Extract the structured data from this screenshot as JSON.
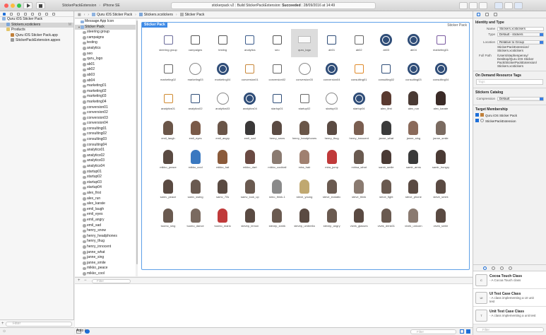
{
  "toolbar": {
    "scheme_target": "StickerPackExtension",
    "device": "iPhone SE",
    "activity_project": "stickerpack v2",
    "activity_status_prefix": "Build StickerPackExtension:",
    "activity_status": "Succeeded",
    "activity_time": "28/09/2016 at 14:49"
  },
  "navigator": {
    "items": [
      {
        "label": "Quru iOS Sticker Pack",
        "indent": 0,
        "kind": "project"
      },
      {
        "label": "Stickers.xcstickers",
        "indent": 1,
        "kind": "file",
        "badge": "M",
        "selected": true
      },
      {
        "label": "Products",
        "indent": 1,
        "kind": "folder"
      },
      {
        "label": "Quru iOS Sticker Pack.app",
        "indent": 2,
        "kind": "app"
      },
      {
        "label": "StickerPackExtension.appex",
        "indent": 2,
        "kind": "appex"
      }
    ],
    "filter_placeholder": "Filter"
  },
  "jumpbar": {
    "crumbs": [
      "Quru iOS Sticker Pack",
      "Stickers.xcstickers",
      "Sticker Pack"
    ]
  },
  "outline": {
    "items": [
      "Message App Icon",
      "Sticker Pack",
      "steering group",
      "campaigns",
      "testing",
      "analytics",
      "seo",
      "quru_logo",
      "ab01",
      "ab02",
      "ab03",
      "ab04",
      "marketing01",
      "marketing02",
      "marketing03",
      "marketing04",
      "conversion01",
      "conversion02",
      "conversion03",
      "conversion04",
      "consulting01",
      "consulting02",
      "consulting03",
      "consulting04",
      "analytics01",
      "analytics02",
      "analytics03",
      "analytics04",
      "startup01",
      "startup02",
      "startup03",
      "startup04",
      "alex_first",
      "alex_run",
      "alex_karate",
      "emil_laugh",
      "emil_eyes",
      "emil_angry",
      "emil_sad",
      "henry_snow",
      "henry_headphones",
      "henry_thug",
      "henry_innocent",
      "janne_what",
      "janne_sing",
      "janne_smile",
      "mikko_peace",
      "mikko_cool"
    ],
    "filter_placeholder": "Filter"
  },
  "pack": {
    "label": "Sticker Pack",
    "right_label": "Sticker Pack",
    "stickers": [
      {
        "name": "steering group",
        "kind": "icon",
        "color": "#6b6b9a"
      },
      {
        "name": "campaigns",
        "kind": "icon",
        "color": "#555"
      },
      {
        "name": "testing",
        "kind": "icon",
        "color": "#555"
      },
      {
        "name": "analytics",
        "kind": "icon",
        "color": "#3a5a8a"
      },
      {
        "name": "seo",
        "kind": "icon",
        "color": "#555"
      },
      {
        "name": "quru_logo",
        "kind": "logo",
        "color": "#bbb",
        "selected": true
      },
      {
        "name": "ab01",
        "kind": "icon",
        "color": "#2f4d78"
      },
      {
        "name": "ab02",
        "kind": "icon",
        "color": "#666"
      },
      {
        "name": "ab03",
        "kind": "circle",
        "color": "#2f4d78"
      },
      {
        "name": "ab04",
        "kind": "circle",
        "color": "#2f4d78"
      },
      {
        "name": "marketing01",
        "kind": "icon",
        "color": "#7a5aa0"
      },
      {
        "name": "marketing02",
        "kind": "icon",
        "color": "#666"
      },
      {
        "name": "marketing03",
        "kind": "ring",
        "color": "#888"
      },
      {
        "name": "marketing04",
        "kind": "circle",
        "color": "#2f4d78"
      },
      {
        "name": "conversion01",
        "kind": "icon",
        "color": "#c8873a"
      },
      {
        "name": "conversion02",
        "kind": "icon",
        "color": "#666"
      },
      {
        "name": "conversion03",
        "kind": "ring",
        "color": "#888"
      },
      {
        "name": "conversion04",
        "kind": "circle",
        "color": "#2f4d78"
      },
      {
        "name": "consulting01",
        "kind": "icon",
        "color": "#e08a2a"
      },
      {
        "name": "consulting02",
        "kind": "icon",
        "color": "#2f4d78"
      },
      {
        "name": "consulting03",
        "kind": "circle",
        "color": "#2f4d78"
      },
      {
        "name": "consulting04",
        "kind": "circle",
        "color": "#2f4d78"
      },
      {
        "name": "analytics01",
        "kind": "icon",
        "color": "#d08a30"
      },
      {
        "name": "analytics02",
        "kind": "icon",
        "color": "#2f4d78"
      },
      {
        "name": "analytics03",
        "kind": "ring",
        "color": "#888"
      },
      {
        "name": "analytics04",
        "kind": "circle",
        "color": "#2f4d78"
      },
      {
        "name": "startup01",
        "kind": "icon",
        "color": "#2f4d78"
      },
      {
        "name": "startup02",
        "kind": "icon",
        "color": "#666"
      },
      {
        "name": "startup03",
        "kind": "ring",
        "color": "#888"
      },
      {
        "name": "startup04",
        "kind": "circle",
        "color": "#2f4d78"
      },
      {
        "name": "alex_first",
        "kind": "photo",
        "color": "#5a3a30"
      },
      {
        "name": "alex_run",
        "kind": "photo",
        "color": "#4a3a34"
      },
      {
        "name": "alex_karate",
        "kind": "photo",
        "color": "#3a2a26"
      },
      {
        "name": "emil_laugh",
        "kind": "photo",
        "color": "#6a5548"
      },
      {
        "name": "emil_eyes",
        "kind": "photo",
        "color": "#7a5a48"
      },
      {
        "name": "emil_angry",
        "kind": "photo",
        "color": "#6a5548"
      },
      {
        "name": "emil_sad",
        "kind": "photo",
        "color": "#3a3838"
      },
      {
        "name": "henry_snow",
        "kind": "photo",
        "color": "#5a4a42"
      },
      {
        "name": "henry_headphones",
        "kind": "photo",
        "color": "#6a5648"
      },
      {
        "name": "henry_thug",
        "kind": "photo",
        "color": "#5a4a42"
      },
      {
        "name": "henry_innocent",
        "kind": "photo",
        "color": "#7a5e50"
      },
      {
        "name": "janne_what",
        "kind": "photo",
        "color": "#3a3a3a"
      },
      {
        "name": "janne_sing",
        "kind": "photo",
        "color": "#8a6a5a"
      },
      {
        "name": "janne_smile",
        "kind": "photo",
        "color": "#7a6a60"
      },
      {
        "name": "mikko_peace",
        "kind": "photo",
        "color": "#5a4a42"
      },
      {
        "name": "mikko_cool",
        "kind": "photo",
        "color": "#3a78c0"
      },
      {
        "name": "mikko_hat",
        "kind": "photo",
        "color": "#8a5a3a"
      },
      {
        "name": "mikko_dart",
        "kind": "photo",
        "color": "#6a4a42"
      },
      {
        "name": "mikko_cocktail",
        "kind": "photo",
        "color": "#8a7a70"
      },
      {
        "name": "mira_hair",
        "kind": "photo",
        "color": "#a08070"
      },
      {
        "name": "mira_jump",
        "kind": "photo",
        "color": "#c03a3a"
      },
      {
        "name": "mirisa_what",
        "kind": "photo",
        "color": "#6a5a50"
      },
      {
        "name": "samir_smile",
        "kind": "photo",
        "color": "#4a3a34"
      },
      {
        "name": "samir_arms",
        "kind": "photo",
        "color": "#3a3a3a"
      },
      {
        "name": "samir_hungry",
        "kind": "photo",
        "color": "#4a3a34"
      },
      {
        "name": "samv_peace",
        "kind": "photo",
        "color": "#5a4a42"
      },
      {
        "name": "samv_swing",
        "kind": "photo",
        "color": "#6a5a50"
      },
      {
        "name": "samv_70s",
        "kind": "photo",
        "color": "#5a4a42"
      },
      {
        "name": "samv_look_up",
        "kind": "photo",
        "color": "#6a5a50"
      },
      {
        "name": "simo_think-1",
        "kind": "photo",
        "color": "#8a8a8a"
      },
      {
        "name": "steve_young",
        "kind": "photo",
        "color": "#c0a870"
      },
      {
        "name": "steve_ecstatic",
        "kind": "photo",
        "color": "#6a5a50"
      },
      {
        "name": "steve_think",
        "kind": "photo",
        "color": "#8a7a70"
      },
      {
        "name": "steve_fight",
        "kind": "photo",
        "color": "#6a5a50"
      },
      {
        "name": "steve_phone",
        "kind": "photo",
        "color": "#5a4a42"
      },
      {
        "name": "steve_smirk",
        "kind": "photo",
        "color": "#5a4a42"
      },
      {
        "name": "tuomo_sing",
        "kind": "photo",
        "color": "#6a5a50"
      },
      {
        "name": "tuomo_dance",
        "kind": "photo",
        "color": "#7a6a60"
      },
      {
        "name": "tuomo_mario",
        "kind": "photo",
        "color": "#c03a3a"
      },
      {
        "name": "stevep_lemon",
        "kind": "photo",
        "color": "#5a4a42"
      },
      {
        "name": "stevep_smirk",
        "kind": "photo",
        "color": "#6a5a50"
      },
      {
        "name": "stevep_umbrella",
        "kind": "photo",
        "color": "#5a4a42"
      },
      {
        "name": "stevep_angry",
        "kind": "photo",
        "color": "#6a5a50"
      },
      {
        "name": "vivek_glasses",
        "kind": "photo",
        "color": "#5a4a42"
      },
      {
        "name": "vivek_drink01",
        "kind": "photo",
        "color": "#6a5a50"
      },
      {
        "name": "vivek_unicorn",
        "kind": "photo",
        "color": "#8a7a70"
      },
      {
        "name": "vivek_smile",
        "kind": "photo",
        "color": "#5a4a42"
      }
    ]
  },
  "status": {
    "auto_label": "Auto ◊",
    "filter_placeholder": "Filter"
  },
  "inspector": {
    "identity_header": "Identity and Type",
    "name_label": "Name",
    "name_value": "Stickers.xcstickers",
    "type_label": "Type",
    "type_value": "Default - stickers",
    "location_label": "Location",
    "location_value": "Relative to Group",
    "location_path": "StickerPackExtension/ Stickers.xcstickers",
    "fullpath_label": "Full Path",
    "fullpath_value": "/Users/stephenpenny/ Desktop/Quru iOS Sticker Pack/StickerPackExtension/ Stickers.xcstickers",
    "odr_header": "On Demand Resource Tags",
    "odr_placeholder": "Tags",
    "catalog_header": "Stickers Catalog",
    "compression_label": "Compression",
    "compression_value": "Default",
    "membership_header": "Target Membership",
    "targets": [
      "Quru iOS Sticker Pack",
      "StickerPackExtension"
    ],
    "library": [
      {
        "title": "Cocoa Touch Class",
        "desc": "- A Cocoa Touch class",
        "icon": "C"
      },
      {
        "title": "UI Test Case Class",
        "desc": "- A class implementing a UI unit test",
        "icon": "UI"
      },
      {
        "title": "Unit Test Case Class",
        "desc": "- A class implementing a unit test",
        "icon": "T"
      }
    ],
    "library_filter": "Filter"
  },
  "colors": {
    "accent": "#1e6fd8",
    "pack_border": "#5ea0e8"
  }
}
